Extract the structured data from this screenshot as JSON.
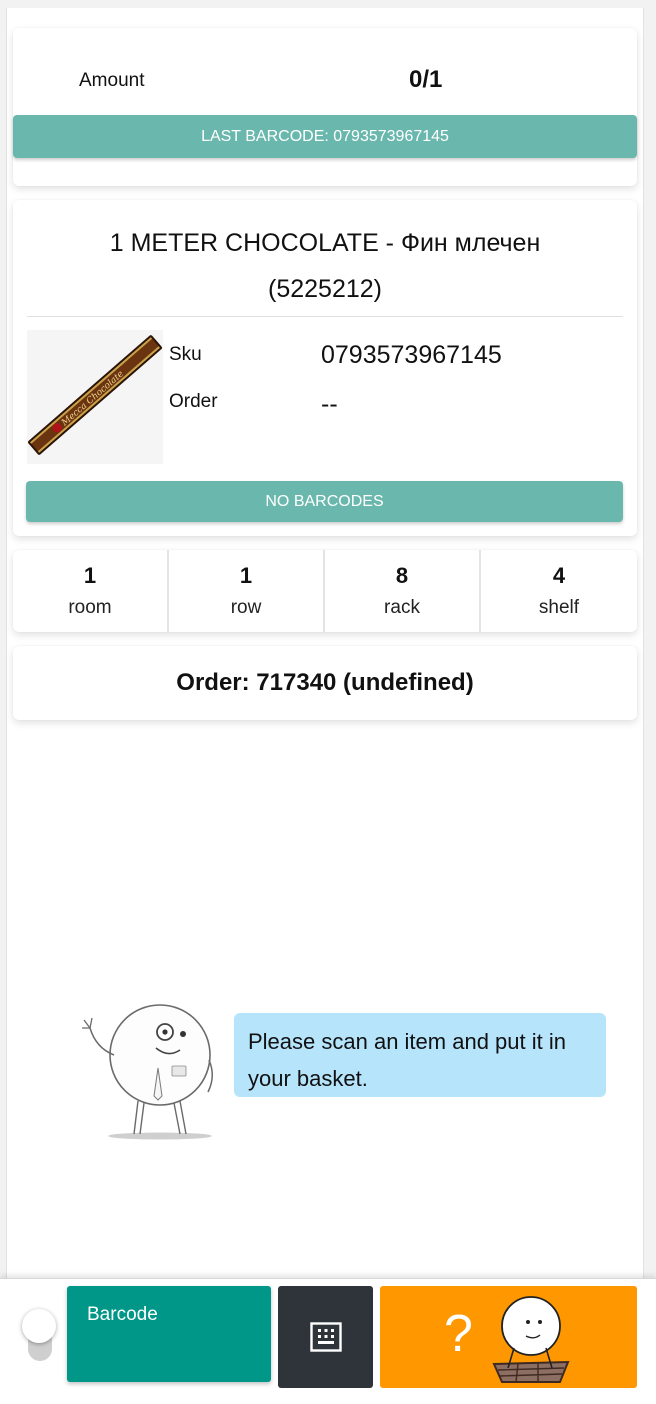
{
  "summary": {
    "amount_label": "Amount",
    "amount_value": "0/1",
    "last_barcode_label": "LAST BARCODE: 0793573967145"
  },
  "product": {
    "title_line1": "1 METER CHOCOLATE - Фин млечен",
    "title_line2": "(5225212)",
    "image_label": "Mecca Chocolate",
    "sku_label": "Sku",
    "sku_value": "0793573967145",
    "order_label": "Order",
    "order_value": "--",
    "no_barcodes_label": "NO BARCODES"
  },
  "location": [
    {
      "value": "1",
      "label": "room"
    },
    {
      "value": "1",
      "label": "row"
    },
    {
      "value": "8",
      "label": "rack"
    },
    {
      "value": "4",
      "label": "shelf"
    }
  ],
  "order_info": "Order: 717340 (undefined)",
  "assistant": {
    "message": "Please scan an item and put it in your basket."
  },
  "bottom_bar": {
    "barcode_label": "Barcode",
    "keypad_icon": "keypad-icon",
    "help_label": "?",
    "colors": {
      "barcode": "#009688",
      "keypad": "#2f343b",
      "help": "#ff9800"
    }
  },
  "colors": {
    "accent": "#6ab8ad",
    "bubble": "#b6e4fb"
  }
}
